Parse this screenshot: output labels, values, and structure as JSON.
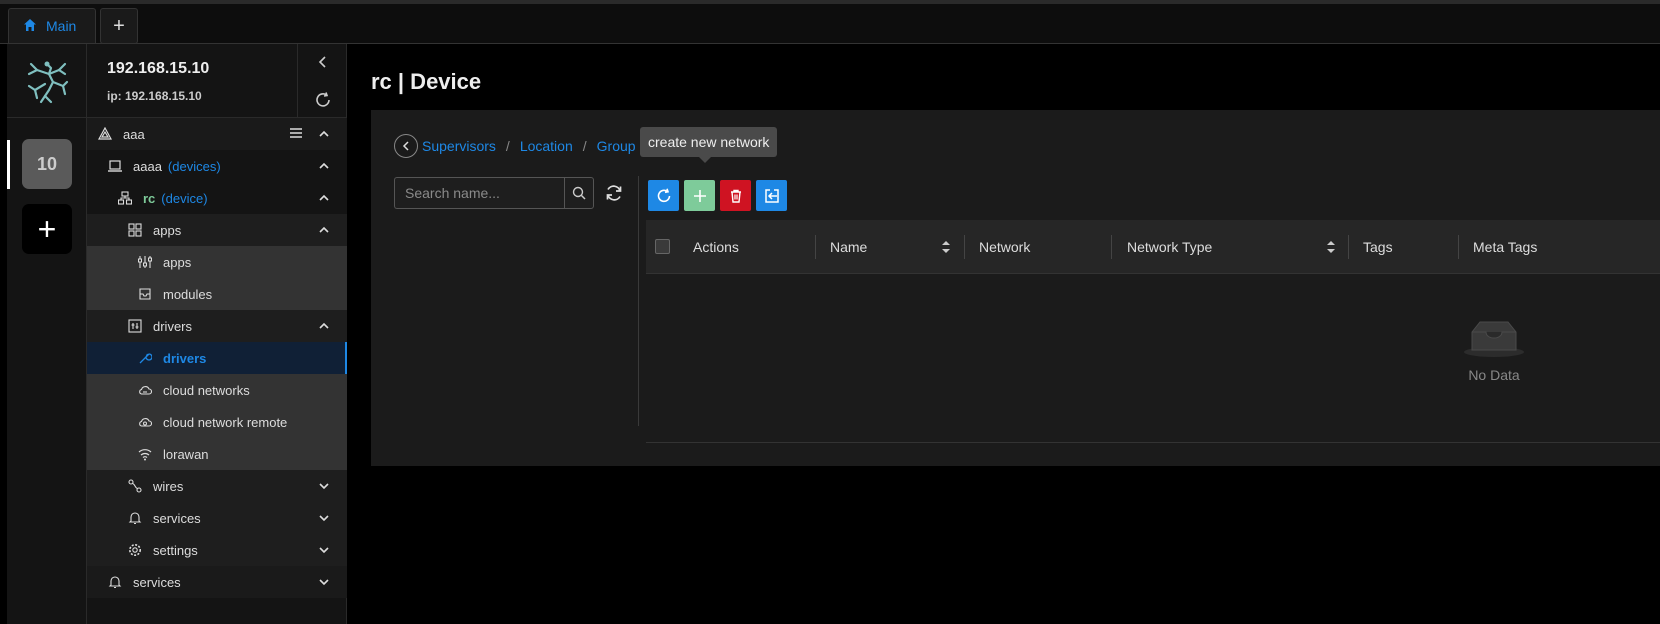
{
  "tabs": {
    "main_label": "Main",
    "add_label": "+"
  },
  "workspace": {
    "badge": "10",
    "add_label": "+"
  },
  "header": {
    "host": "192.168.15.10",
    "ip": "ip: 192.168.15.10"
  },
  "tree": {
    "aaa": "aaa",
    "aaaa": "aaaa",
    "aaaa_type": "(devices)",
    "rc": "rc",
    "rc_type": "(device)",
    "apps_group": "apps",
    "apps": "apps",
    "modules": "modules",
    "drivers_group": "drivers",
    "drivers": "drivers",
    "cloud_networks": "cloud networks",
    "cloud_network_remote": "cloud network remote",
    "lorawan": "lorawan",
    "wires": "wires",
    "services": "services",
    "settings": "settings",
    "services_root": "services"
  },
  "page": {
    "title": "rc | Device"
  },
  "breadcrumb": {
    "items": [
      "Supervisors",
      "Location",
      "Group"
    ],
    "sep": "/"
  },
  "tooltip": "create new network",
  "search": {
    "placeholder": "Search name..."
  },
  "table": {
    "columns": [
      "Actions",
      "Name",
      "Network",
      "Network Type",
      "Tags",
      "Meta Tags"
    ],
    "empty_text": "No Data"
  },
  "colors": {
    "accent": "#1e88e5",
    "refresh_btn": "#1e88e5",
    "create_btn": "#7ecb9a",
    "delete_btn": "#cf1322",
    "export_btn": "#1e88e5",
    "logo": "#7fbfbf"
  }
}
